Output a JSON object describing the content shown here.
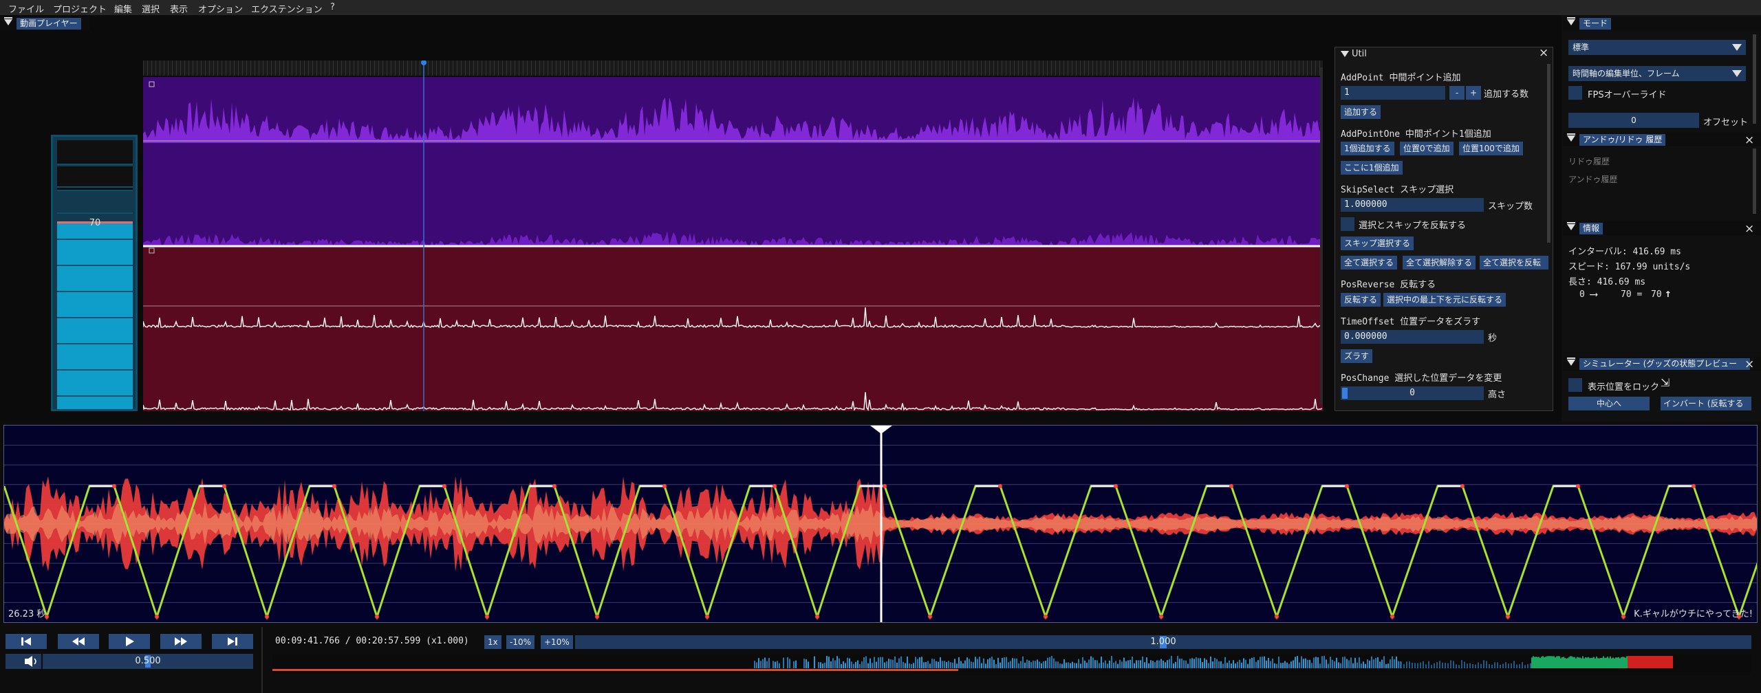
{
  "menu": [
    "ファイル",
    "プロジェクト",
    "編集",
    "選択",
    "表示",
    "オプション",
    "エクステンション",
    "?"
  ],
  "video_player": {
    "title": "動画プレイヤー",
    "meter_value": "70",
    "meter_level": 0.7
  },
  "util": {
    "title": "Util",
    "add_point": {
      "label": "AddPoint 中間ポイント追加",
      "value": "1",
      "minus": "-",
      "plus": "+",
      "count_label": "追加する数",
      "button": "追加する"
    },
    "add_point_one": {
      "label": "AddPointOne 中間ポイント1個追加",
      "btn1": "1個追加する",
      "btn2": "位置0で追加",
      "btn3": "位置100で追加",
      "btn4": "ここに1個追加"
    },
    "skip_select": {
      "label": "SkipSelect スキップ選択",
      "value": "1.000000",
      "count_label": "スキップ数",
      "invert_label": "選択とスキップを反転する",
      "button": "スキップ選択する"
    },
    "select_buttons": [
      "全て選択する",
      "全て選択解除する",
      "全て選択を反転"
    ],
    "pos_reverse": {
      "label": "PosReverse 反転する",
      "btn1": "反転する",
      "btn2": "選択中の最上下を元に反転する"
    },
    "time_offset": {
      "label": "TimeOffset 位置データをズラす",
      "value": "0.000000",
      "unit": "秒",
      "button": "ズラす"
    },
    "pos_change": {
      "label": "PosChange 選択した位置データを変更",
      "value": "0",
      "unit": "高さ"
    }
  },
  "mode": {
    "title": "モード",
    "select1": "標準",
    "select2": "時間軸の編集単位、フレーム",
    "fps_override": "FPSオーバーライド",
    "offset_value": "0",
    "offset_label": "オフセット"
  },
  "undo": {
    "title": "アンドゥ/リドゥ 履歴",
    "redo": "リドゥ履歴",
    "undo": "アンドゥ履歴"
  },
  "info": {
    "title": "情報",
    "interval": "インターバル: 416.69 ms",
    "speed": "スピード: 167.99 units/s",
    "length": "長さ: 416.69 ms",
    "from": "0",
    "to_mid": "70 =",
    "to": "70"
  },
  "simulator": {
    "title": "シミュレーター (グッズの状態プレビュー",
    "lock_label": "表示位置をロック",
    "center_button": "中心へ",
    "invert_button": "インバート (反転する"
  },
  "funscript": {
    "time_label": "26.23 秒",
    "title_label": "K.ギャルがウチにやってきた!"
  },
  "transport": {
    "time": "00:09:41.766 / 00:20:57.599 (x1.000)",
    "chips": [
      "1x",
      "-10%",
      "+10%"
    ],
    "speed_value": "1.000",
    "volume_value": "0.500",
    "playback_progress": 0.46,
    "speed_slider": 0.5,
    "volume_slider": 0.5
  },
  "colors": {
    "accent": "#294a7a",
    "purple_wave": "#8a2be2",
    "purple_bg": "#3d0a75",
    "maroon_bg": "#5a0a1e",
    "script_line": "#a6e22e",
    "audio_red": "#e83a3a",
    "meter_fill": "#0f9ec9"
  }
}
